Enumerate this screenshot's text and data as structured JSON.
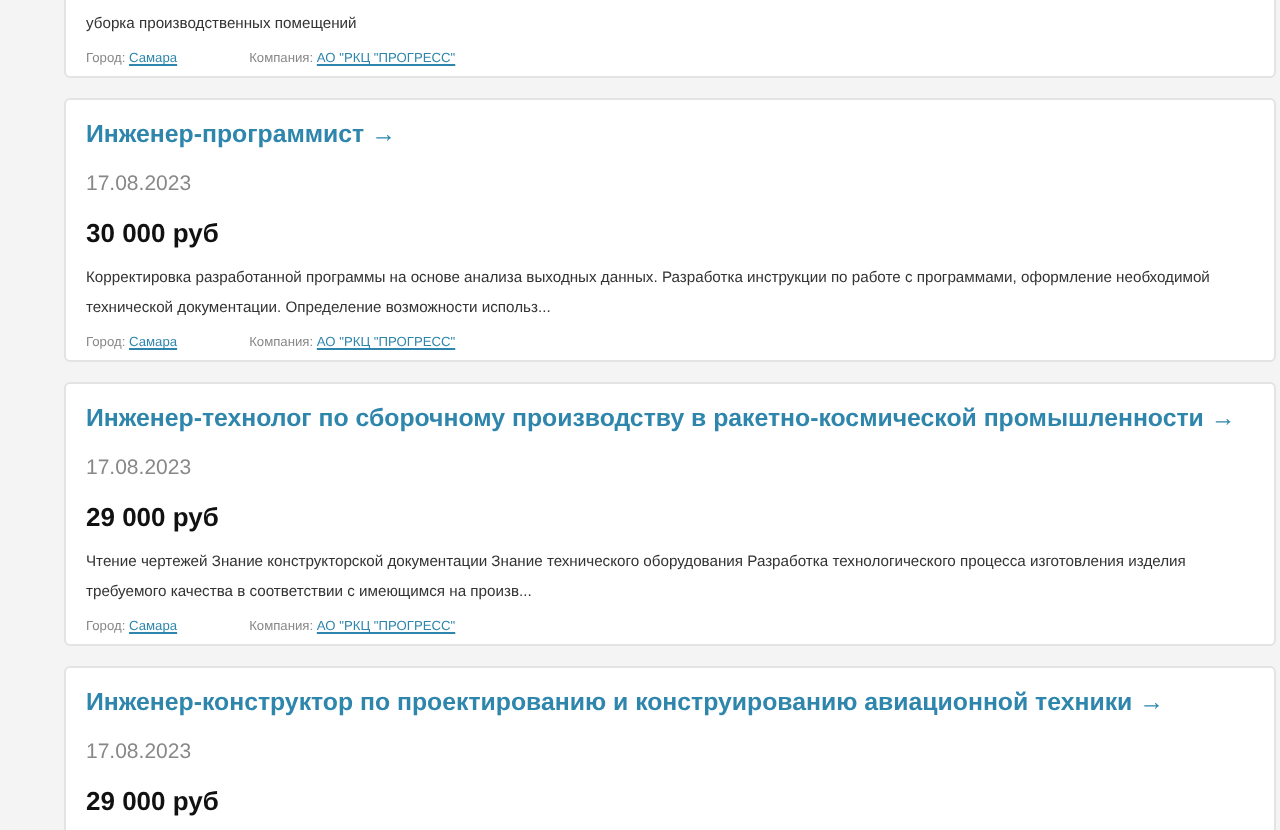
{
  "vacancies": [
    {
      "description": "уборка производственных помещений",
      "city_label": "Город:",
      "city": "Самара",
      "company_label": "Компания:",
      "company": "АО \"РКЦ \"ПРОГРЕСС\""
    },
    {
      "title": "Инженер-программист →",
      "date": "17.08.2023",
      "salary": "30 000 руб",
      "description": "Корректировка разработанной программы на основе анализа выходных данных. Разработка инструкции по работе с программами, оформление необходимой технической документации. Определение возможности использ...",
      "city_label": "Город:",
      "city": "Самара",
      "company_label": "Компания:",
      "company": "АО \"РКЦ \"ПРОГРЕСС\""
    },
    {
      "title": "Инженер-технолог по сборочному производству в ракетно-космической промышленности →",
      "date": "17.08.2023",
      "salary": "29 000 руб",
      "description": "Чтение чертежей Знание конструкторской документации Знание технического оборудования Разработка технологического процесса изготовления изделия требуемого качества в соответствии с имеющимся на произв...",
      "city_label": "Город:",
      "city": "Самара",
      "company_label": "Компания:",
      "company": "АО \"РКЦ \"ПРОГРЕСС\""
    },
    {
      "title": "Инженер-конструктор по проектированию и конструированию авиационной техники →",
      "date": "17.08.2023",
      "salary": "29 000 руб"
    }
  ]
}
